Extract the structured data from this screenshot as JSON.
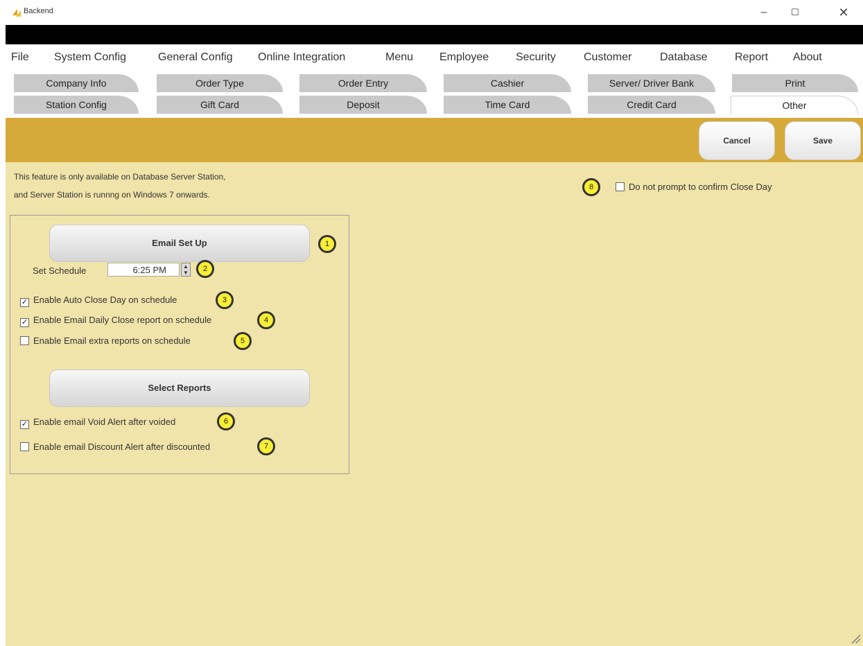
{
  "window": {
    "title": "Backend",
    "minimize_glyph": "–",
    "maximize_glyph": "☐",
    "close_glyph": "✕"
  },
  "menu": [
    "File",
    "System Config",
    "General Config",
    "Online Integration",
    "Menu",
    "Employee",
    "Security",
    "Customer",
    "Database",
    "Report",
    "About"
  ],
  "tabs_row1": [
    "Company Info",
    "Order Type",
    "Order Entry",
    "Cashier",
    "Server/ Driver Bank",
    "Print"
  ],
  "tabs_row2": [
    "Station Config",
    "Gift Card",
    "Deposit",
    "Time Card",
    "Credit Card",
    "Other"
  ],
  "active_tab": "Other",
  "toolbar": {
    "cancel_label": "Cancel",
    "save_label": "Save"
  },
  "content": {
    "note_line1": "This feature is only available on Database Server Station,",
    "note_line2": "and Server Station is runnng on Windows 7 onwards.",
    "email_setup_label": "Email Set Up",
    "schedule_label": "Set Schedule",
    "schedule_value": "6:25 PM",
    "checks": [
      {
        "label": "Enable Auto Close Day on schedule",
        "checked": true
      },
      {
        "label": "Enable Email Daily Close report on schedule",
        "checked": true
      },
      {
        "label": "Enable Email extra reports on schedule",
        "checked": false
      }
    ],
    "select_reports_label": "Select Reports",
    "alerts": [
      {
        "label": "Enable email Void Alert after voided",
        "checked": true
      },
      {
        "label": "Enable email Discount Alert after discounted",
        "checked": false
      }
    ],
    "close_day_prompt": {
      "label": "Do not prompt to confirm Close Day",
      "checked": false
    }
  },
  "badges": [
    "1",
    "2",
    "3",
    "4",
    "5",
    "6",
    "7",
    "8"
  ],
  "colors": {
    "toolbar": "#d6aa3a",
    "content_bg": "#f1e4aa",
    "badge": "#f7ee35"
  }
}
